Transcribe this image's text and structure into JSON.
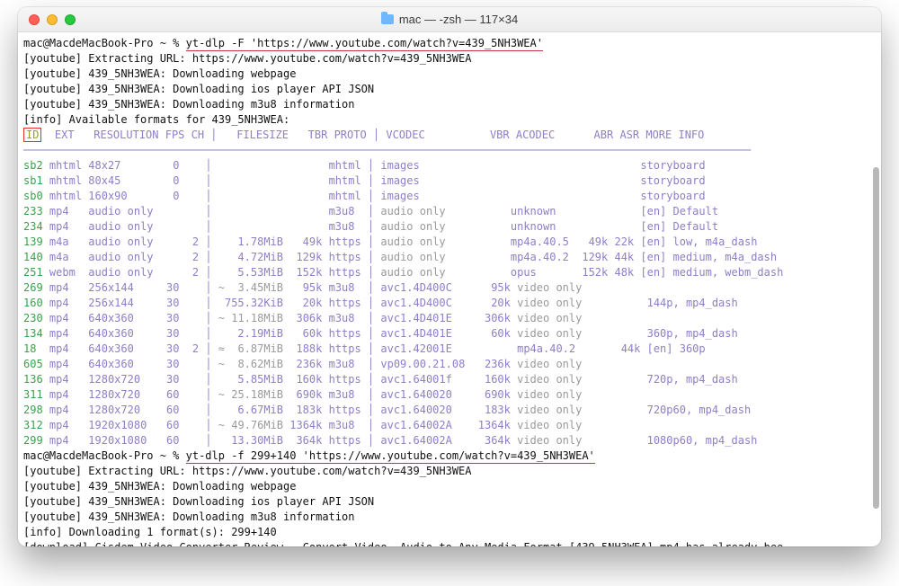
{
  "window": {
    "title": "mac — -zsh — 117×34"
  },
  "prompt1": {
    "prefix": "mac@MacdeMacBook-Pro ~ % ",
    "command": "yt-dlp -F 'https://www.youtube.com/watch?v=439_5NH3WEA'"
  },
  "log1": [
    "[youtube] Extracting URL: https://www.youtube.com/watch?v=439_5NH3WEA",
    "[youtube] 439_5NH3WEA: Downloading webpage",
    "[youtube] 439_5NH3WEA: Downloading ios player API JSON",
    "[youtube] 439_5NH3WEA: Downloading m3u8 information",
    "[info] Available formats for 439_5NH3WEA:"
  ],
  "header": {
    "id": "ID",
    "rest": "EXT   RESOLUTION FPS CH │   FILESIZE   TBR PROTO │ VCODEC          VBR ACODEC      ABR ASR MORE INFO"
  },
  "sep": "────────────────────────────────────────────────────────────────────────────────────────────────────────────────",
  "formats": [
    {
      "id": "sb2",
      "rest": "mhtml 48x27        0    │                  mhtml │ images                                  storyboard"
    },
    {
      "id": "sb1",
      "rest": "mhtml 80x45        0    │                  mhtml │ images                                  storyboard"
    },
    {
      "id": "sb0",
      "rest": "mhtml 160x90       0    │                  mhtml │ images                                  storyboard"
    },
    {
      "id": "233",
      "rest": "mp4   audio only        │                  m3u8  │ ",
      "gray": "audio only",
      "rest2": "          unknown             [en] Default"
    },
    {
      "id": "234",
      "rest": "mp4   audio only        │                  m3u8  │ ",
      "gray": "audio only",
      "rest2": "          unknown             [en] Default"
    },
    {
      "id": "139",
      "rest": "m4a   audio only      2 │    1.78MiB   49k https │ ",
      "gray": "audio only",
      "rest2": "          mp4a.40.5   49k 22k [en] low, m4a_dash"
    },
    {
      "id": "140",
      "rest": "m4a   audio only      2 │    4.72MiB  129k https │ ",
      "gray": "audio only",
      "rest2": "          mp4a.40.2  129k 44k [en] medium, m4a_dash"
    },
    {
      "id": "251",
      "rest": "webm  audio only      2 │    5.53MiB  152k https │ ",
      "gray": "audio only",
      "rest2": "          opus       152k 48k [en] medium, webm_dash"
    },
    {
      "id": "269",
      "rest": "mp4   256x144     30    │ ",
      "gray": "~  3.45MiB",
      "rest2": "   95k m3u8  │ avc1.4D400C      95k ",
      "gray2": "video only"
    },
    {
      "id": "160",
      "rest": "mp4   256x144     30    │  755.32KiB   20k https │ avc1.4D400C      20k ",
      "gray": "video only",
      "rest2": "          144p, mp4_dash"
    },
    {
      "id": "230",
      "rest": "mp4   640x360     30    │ ",
      "gray": "~ 11.18MiB",
      "rest2": "  306k m3u8  │ avc1.4D401E     306k ",
      "gray2": "video only"
    },
    {
      "id": "134",
      "rest": "mp4   640x360     30    │    2.19MiB   60k https │ avc1.4D401E      60k ",
      "gray": "video only",
      "rest2": "          360p, mp4_dash"
    },
    {
      "id": "18",
      "rest": "mp4   640x360     30  2 │ ",
      "gray": "≈  6.87MiB",
      "rest2": "  188k https │ avc1.42001E          mp4a.40.2       44k [en] 360p"
    },
    {
      "id": "605",
      "rest": "mp4   640x360     30    │ ",
      "gray": "~  8.62MiB",
      "rest2": "  236k m3u8  │ vp09.00.21.08   236k ",
      "gray2": "video only"
    },
    {
      "id": "136",
      "rest": "mp4   1280x720    30    │    5.85MiB  160k https │ avc1.64001f     160k ",
      "gray": "video only",
      "rest2": "          720p, mp4_dash"
    },
    {
      "id": "311",
      "rest": "mp4   1280x720    60    │ ",
      "gray": "~ 25.18MiB",
      "rest2": "  690k m3u8  │ avc1.640020     690k ",
      "gray2": "video only"
    },
    {
      "id": "298",
      "rest": "mp4   1280x720    60    │    6.67MiB  183k https │ avc1.640020     183k ",
      "gray": "video only",
      "rest2": "          720p60, mp4_dash"
    },
    {
      "id": "312",
      "rest": "mp4   1920x1080   60    │ ",
      "gray": "~ 49.76MiB",
      "rest2": " 1364k m3u8  │ avc1.64002A    1364k ",
      "gray2": "video only"
    },
    {
      "id": "299",
      "rest": "mp4   1920x1080   60    │   13.30MiB  364k https │ avc1.64002A     364k ",
      "gray": "video only",
      "rest2": "          1080p60, mp4_dash"
    }
  ],
  "prompt2": {
    "prefix": "mac@MacdeMacBook-Pro ~ % ",
    "command": "yt-dlp -f 299+140 'https://www.youtube.com/watch?v=439_5NH3WEA'"
  },
  "log2": [
    "[youtube] Extracting URL: https://www.youtube.com/watch?v=439_5NH3WEA",
    "[youtube] 439_5NH3WEA: Downloading webpage",
    "[youtube] 439_5NH3WEA: Downloading ios player API JSON",
    "[youtube] 439_5NH3WEA: Downloading m3u8 information",
    "[info] Downloading 1 format(s): 299+140",
    "[download] Cisdem Video Converter Review – Convert Video, Audio to Any Media Format [439_5NH3WEA].mp4 has already bee"
  ]
}
